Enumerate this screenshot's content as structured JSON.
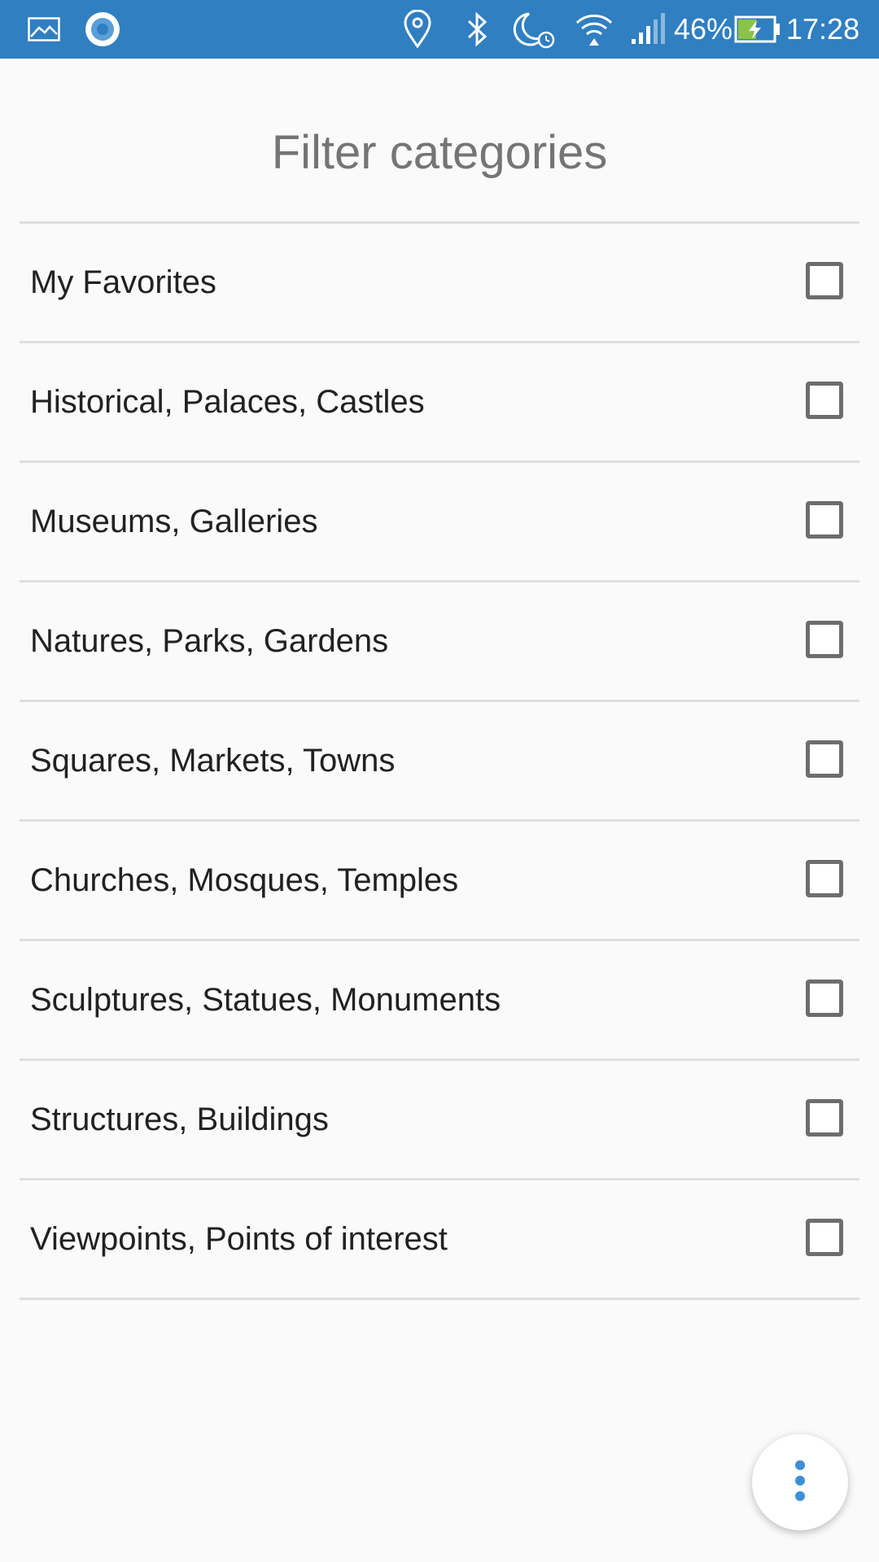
{
  "status_bar": {
    "battery_percent": "46%",
    "time": "17:28",
    "icons": [
      "image-icon",
      "record-icon",
      "location-icon",
      "bluetooth-icon",
      "do-not-disturb-alarm-icon",
      "wifi-icon",
      "signal-icon",
      "battery-charging-icon"
    ]
  },
  "header": {
    "title": "Filter categories"
  },
  "categories": [
    {
      "label": "My Favorites",
      "checked": false
    },
    {
      "label": "Historical, Palaces, Castles",
      "checked": false
    },
    {
      "label": "Museums, Galleries",
      "checked": false
    },
    {
      "label": "Natures, Parks, Gardens",
      "checked": false
    },
    {
      "label": "Squares, Markets, Towns",
      "checked": false
    },
    {
      "label": "Churches, Mosques, Temples",
      "checked": false
    },
    {
      "label": "Sculptures, Statues, Monuments",
      "checked": false
    },
    {
      "label": "Structures, Buildings",
      "checked": false
    },
    {
      "label": "Viewpoints, Points of interest",
      "checked": false
    }
  ],
  "fab": {
    "icon": "more-vert-icon"
  },
  "colors": {
    "status_bar": "#2f7fc1",
    "accent": "#3d8fd6",
    "background": "#fafafa",
    "divider": "#dedede"
  }
}
